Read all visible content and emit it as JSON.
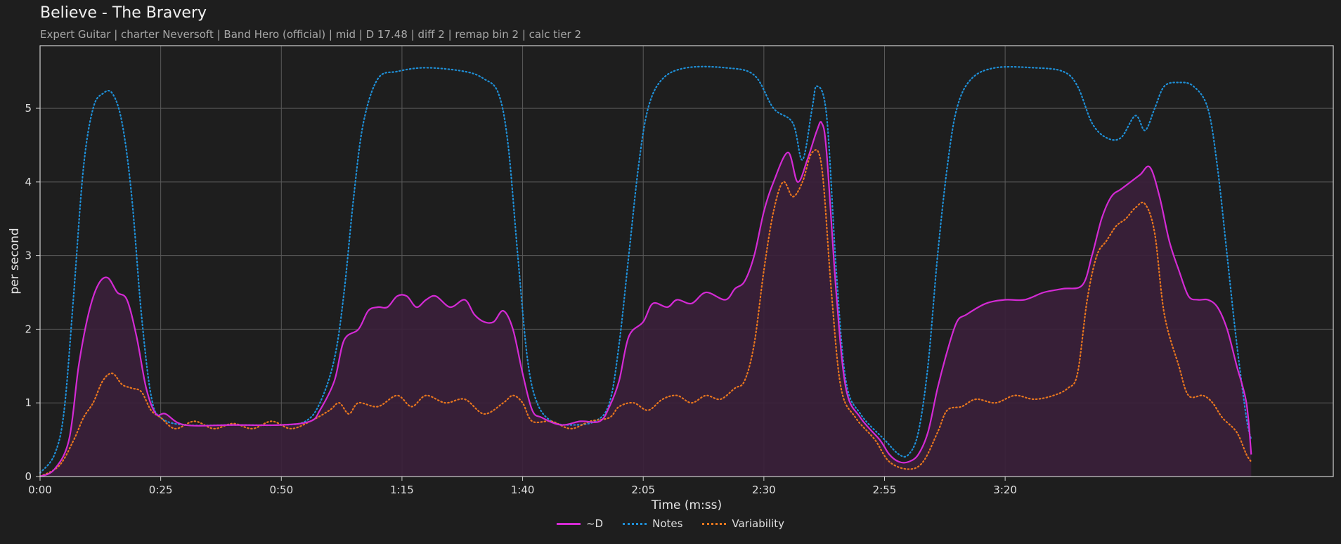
{
  "title": "Believe - The Bravery",
  "subtitle": "Expert Guitar  |  charter Neversoft  |  Band Hero (official)  |  mid  |  D 17.48  |  diff 2  |  remap bin 2  |  calc tier 2",
  "colors": {
    "background": "#1e1e1e",
    "d": "#d42ad4",
    "notes": "#1f8fd6",
    "variability": "#e8761e",
    "fill": "#3a1f3a"
  },
  "chart_data": {
    "type": "line",
    "xlabel": "Time (m:ss)",
    "ylabel": "per second",
    "xlim": [
      0,
      268
    ],
    "ylim": [
      0,
      5.85
    ],
    "x_ticks": [
      0,
      25,
      50,
      75,
      100,
      125,
      150,
      175,
      200
    ],
    "x_tick_labels": [
      "0:00",
      "0:25",
      "0:50",
      "1:15",
      "1:40",
      "2:05",
      "2:30",
      "2:55",
      "3:20"
    ],
    "y_ticks": [
      0,
      1,
      2,
      3,
      4,
      5
    ],
    "y_tick_labels": [
      "0",
      "1",
      "2",
      "3",
      "4",
      "5"
    ],
    "grid": true,
    "legend_position": "bottom-center",
    "series": [
      {
        "name": "~D",
        "style": "solid",
        "color": "#d42ad4",
        "filled": true,
        "points": [
          [
            0,
            0
          ],
          [
            3,
            0.1
          ],
          [
            6,
            0.5
          ],
          [
            8,
            1.5
          ],
          [
            10,
            2.2
          ],
          [
            12,
            2.6
          ],
          [
            14,
            2.7
          ],
          [
            16,
            2.5
          ],
          [
            18,
            2.4
          ],
          [
            20,
            1.9
          ],
          [
            22,
            1.2
          ],
          [
            24,
            0.85
          ],
          [
            26,
            0.85
          ],
          [
            30,
            0.7
          ],
          [
            40,
            0.7
          ],
          [
            50,
            0.7
          ],
          [
            56,
            0.75
          ],
          [
            58,
            0.9
          ],
          [
            61,
            1.3
          ],
          [
            63,
            1.85
          ],
          [
            66,
            2.0
          ],
          [
            68,
            2.25
          ],
          [
            70,
            2.3
          ],
          [
            72,
            2.3
          ],
          [
            74,
            2.45
          ],
          [
            76,
            2.45
          ],
          [
            78,
            2.3
          ],
          [
            80,
            2.4
          ],
          [
            82,
            2.45
          ],
          [
            85,
            2.3
          ],
          [
            88,
            2.4
          ],
          [
            90,
            2.2
          ],
          [
            92,
            2.1
          ],
          [
            94,
            2.1
          ],
          [
            96,
            2.25
          ],
          [
            98,
            2.0
          ],
          [
            100,
            1.4
          ],
          [
            102,
            0.9
          ],
          [
            104,
            0.8
          ],
          [
            108,
            0.7
          ],
          [
            112,
            0.75
          ],
          [
            116,
            0.75
          ],
          [
            118,
            0.95
          ],
          [
            120,
            1.3
          ],
          [
            122,
            1.9
          ],
          [
            125,
            2.1
          ],
          [
            127,
            2.35
          ],
          [
            130,
            2.3
          ],
          [
            132,
            2.4
          ],
          [
            135,
            2.35
          ],
          [
            138,
            2.5
          ],
          [
            142,
            2.4
          ],
          [
            144,
            2.55
          ],
          [
            146,
            2.65
          ],
          [
            148,
            3.0
          ],
          [
            150,
            3.6
          ],
          [
            152,
            4.0
          ],
          [
            155,
            4.4
          ],
          [
            157,
            4.0
          ],
          [
            159,
            4.3
          ],
          [
            161,
            4.7
          ],
          [
            162,
            4.8
          ],
          [
            163,
            4.4
          ],
          [
            165,
            2.5
          ],
          [
            167,
            1.2
          ],
          [
            170,
            0.8
          ],
          [
            174,
            0.5
          ],
          [
            176,
            0.3
          ],
          [
            178,
            0.2
          ],
          [
            180,
            0.2
          ],
          [
            182,
            0.3
          ],
          [
            184,
            0.6
          ],
          [
            186,
            1.2
          ],
          [
            188,
            1.7
          ],
          [
            190,
            2.1
          ],
          [
            192,
            2.2
          ],
          [
            196,
            2.35
          ],
          [
            200,
            2.4
          ],
          [
            204,
            2.4
          ],
          [
            208,
            2.5
          ],
          [
            212,
            2.55
          ],
          [
            216,
            2.6
          ],
          [
            218,
            3.0
          ],
          [
            220,
            3.5
          ],
          [
            222,
            3.8
          ],
          [
            224,
            3.9
          ],
          [
            226,
            4.0
          ],
          [
            228,
            4.1
          ],
          [
            230,
            4.2
          ],
          [
            232,
            3.8
          ],
          [
            234,
            3.2
          ],
          [
            236,
            2.8
          ],
          [
            238,
            2.45
          ],
          [
            240,
            2.4
          ],
          [
            242,
            2.4
          ],
          [
            244,
            2.3
          ],
          [
            246,
            2.0
          ],
          [
            248,
            1.5
          ],
          [
            250,
            1.0
          ],
          [
            251,
            0.3
          ]
        ]
      },
      {
        "name": "Notes",
        "style": "dotted",
        "color": "#1f8fd6",
        "filled": false,
        "points": [
          [
            0,
            0.05
          ],
          [
            3,
            0.3
          ],
          [
            5,
            0.9
          ],
          [
            7,
            2.5
          ],
          [
            9,
            4.2
          ],
          [
            11,
            5.0
          ],
          [
            13,
            5.2
          ],
          [
            15,
            5.2
          ],
          [
            17,
            4.8
          ],
          [
            19,
            3.8
          ],
          [
            21,
            2.2
          ],
          [
            23,
            1.1
          ],
          [
            25,
            0.8
          ],
          [
            30,
            0.7
          ],
          [
            40,
            0.7
          ],
          [
            50,
            0.7
          ],
          [
            55,
            0.75
          ],
          [
            58,
            1.0
          ],
          [
            61,
            1.6
          ],
          [
            63,
            2.5
          ],
          [
            65,
            3.8
          ],
          [
            67,
            4.8
          ],
          [
            70,
            5.4
          ],
          [
            74,
            5.5
          ],
          [
            80,
            5.55
          ],
          [
            88,
            5.5
          ],
          [
            92,
            5.4
          ],
          [
            95,
            5.2
          ],
          [
            97,
            4.5
          ],
          [
            99,
            3.0
          ],
          [
            101,
            1.6
          ],
          [
            103,
            1.0
          ],
          [
            106,
            0.75
          ],
          [
            110,
            0.7
          ],
          [
            115,
            0.75
          ],
          [
            118,
            1.0
          ],
          [
            120,
            1.8
          ],
          [
            122,
            3.0
          ],
          [
            124,
            4.2
          ],
          [
            126,
            5.0
          ],
          [
            129,
            5.4
          ],
          [
            134,
            5.55
          ],
          [
            142,
            5.55
          ],
          [
            148,
            5.45
          ],
          [
            152,
            5.0
          ],
          [
            156,
            4.8
          ],
          [
            158,
            4.3
          ],
          [
            160,
            5.0
          ],
          [
            161,
            5.3
          ],
          [
            163,
            4.9
          ],
          [
            165,
            2.8
          ],
          [
            167,
            1.3
          ],
          [
            170,
            0.85
          ],
          [
            175,
            0.5
          ],
          [
            178,
            0.3
          ],
          [
            180,
            0.3
          ],
          [
            182,
            0.6
          ],
          [
            184,
            1.5
          ],
          [
            186,
            3.0
          ],
          [
            188,
            4.2
          ],
          [
            190,
            5.0
          ],
          [
            193,
            5.4
          ],
          [
            198,
            5.55
          ],
          [
            206,
            5.55
          ],
          [
            212,
            5.5
          ],
          [
            215,
            5.3
          ],
          [
            218,
            4.8
          ],
          [
            221,
            4.6
          ],
          [
            224,
            4.6
          ],
          [
            227,
            4.9
          ],
          [
            229,
            4.7
          ],
          [
            231,
            5.0
          ],
          [
            233,
            5.3
          ],
          [
            236,
            5.35
          ],
          [
            239,
            5.3
          ],
          [
            242,
            5.0
          ],
          [
            244,
            4.2
          ],
          [
            246,
            3.0
          ],
          [
            248,
            1.8
          ],
          [
            250,
            0.8
          ],
          [
            251,
            0.5
          ]
        ]
      },
      {
        "name": "Variability",
        "style": "dotted",
        "color": "#e8761e",
        "filled": false,
        "points": [
          [
            0,
            0
          ],
          [
            4,
            0.15
          ],
          [
            7,
            0.5
          ],
          [
            9,
            0.8
          ],
          [
            11,
            1.0
          ],
          [
            13,
            1.3
          ],
          [
            15,
            1.4
          ],
          [
            17,
            1.25
          ],
          [
            19,
            1.2
          ],
          [
            21,
            1.15
          ],
          [
            23,
            0.9
          ],
          [
            25,
            0.8
          ],
          [
            28,
            0.65
          ],
          [
            32,
            0.75
          ],
          [
            36,
            0.65
          ],
          [
            40,
            0.72
          ],
          [
            44,
            0.65
          ],
          [
            48,
            0.75
          ],
          [
            52,
            0.65
          ],
          [
            56,
            0.75
          ],
          [
            60,
            0.9
          ],
          [
            62,
            1.0
          ],
          [
            64,
            0.85
          ],
          [
            66,
            1.0
          ],
          [
            70,
            0.95
          ],
          [
            74,
            1.1
          ],
          [
            77,
            0.95
          ],
          [
            80,
            1.1
          ],
          [
            84,
            1.0
          ],
          [
            88,
            1.05
          ],
          [
            92,
            0.85
          ],
          [
            96,
            1.0
          ],
          [
            98,
            1.1
          ],
          [
            100,
            1.0
          ],
          [
            102,
            0.75
          ],
          [
            106,
            0.75
          ],
          [
            110,
            0.65
          ],
          [
            114,
            0.75
          ],
          [
            118,
            0.8
          ],
          [
            120,
            0.95
          ],
          [
            123,
            1.0
          ],
          [
            126,
            0.9
          ],
          [
            129,
            1.05
          ],
          [
            132,
            1.1
          ],
          [
            135,
            1.0
          ],
          [
            138,
            1.1
          ],
          [
            141,
            1.05
          ],
          [
            144,
            1.2
          ],
          [
            146,
            1.3
          ],
          [
            148,
            1.8
          ],
          [
            150,
            2.8
          ],
          [
            152,
            3.6
          ],
          [
            154,
            4.0
          ],
          [
            156,
            3.8
          ],
          [
            158,
            4.0
          ],
          [
            160,
            4.4
          ],
          [
            162,
            4.2
          ],
          [
            164,
            2.5
          ],
          [
            166,
            1.2
          ],
          [
            169,
            0.8
          ],
          [
            173,
            0.5
          ],
          [
            176,
            0.2
          ],
          [
            180,
            0.1
          ],
          [
            183,
            0.2
          ],
          [
            186,
            0.6
          ],
          [
            188,
            0.9
          ],
          [
            191,
            0.95
          ],
          [
            194,
            1.05
          ],
          [
            198,
            1.0
          ],
          [
            202,
            1.1
          ],
          [
            206,
            1.05
          ],
          [
            210,
            1.1
          ],
          [
            213,
            1.2
          ],
          [
            215,
            1.4
          ],
          [
            217,
            2.4
          ],
          [
            219,
            3.0
          ],
          [
            221,
            3.2
          ],
          [
            223,
            3.4
          ],
          [
            225,
            3.5
          ],
          [
            227,
            3.65
          ],
          [
            229,
            3.7
          ],
          [
            231,
            3.3
          ],
          [
            233,
            2.2
          ],
          [
            236,
            1.5
          ],
          [
            238,
            1.1
          ],
          [
            241,
            1.1
          ],
          [
            243,
            1.0
          ],
          [
            245,
            0.8
          ],
          [
            248,
            0.6
          ],
          [
            250,
            0.3
          ],
          [
            251,
            0.2
          ]
        ]
      }
    ]
  }
}
